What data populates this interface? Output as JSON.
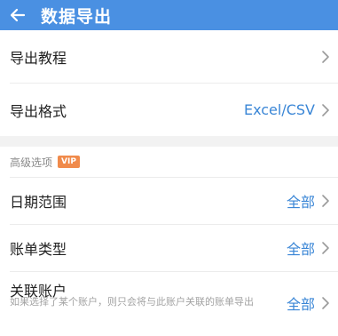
{
  "appbar": {
    "title": "数据导出",
    "back_icon": "arrow-left-icon"
  },
  "main": {
    "items": [
      {
        "label": "导出教程",
        "value": ""
      },
      {
        "label": "导出格式",
        "value": "Excel/CSV"
      }
    ]
  },
  "advanced": {
    "section_label": "高级选项",
    "badge": "VIP",
    "items": [
      {
        "label": "日期范围",
        "value": "全部"
      },
      {
        "label": "账单类型",
        "value": "全部"
      },
      {
        "label": "关联账户",
        "value": "全部",
        "description": "如果选择了某个账户，则只会将与此账户关联的账单导出"
      }
    ]
  },
  "colors": {
    "appbar": "#4a90e2",
    "accent_value": "#3a86d6",
    "badge": "#f08a4b"
  }
}
